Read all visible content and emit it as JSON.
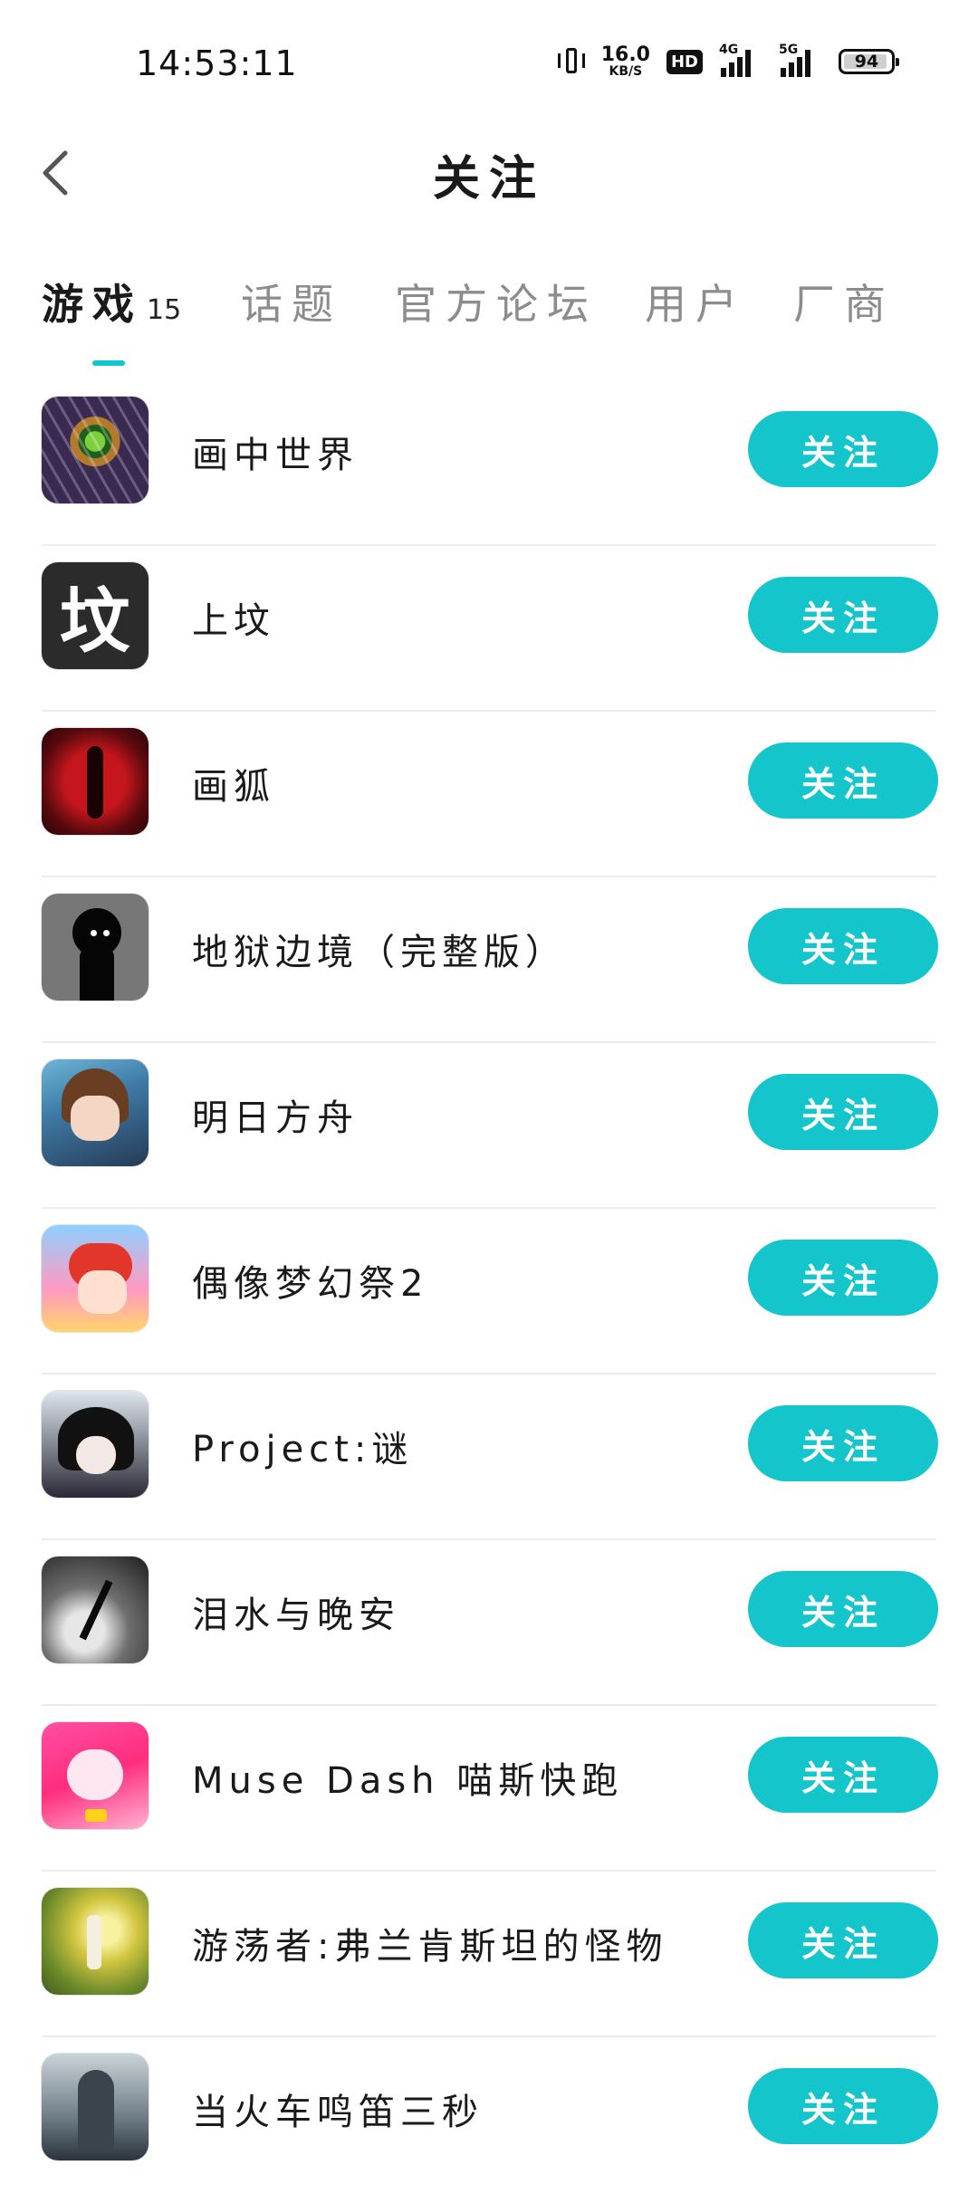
{
  "status_bar": {
    "time": "14:53:11",
    "net_speed_value": "16.0",
    "net_speed_unit": "KB/S",
    "hd_label": "HD",
    "sim1_label": "4G",
    "sim2_label": "5G",
    "battery_level": "94",
    "battery_fraction": 0.94
  },
  "header": {
    "title": "关注",
    "back_icon": "chevron-left-icon"
  },
  "tabs": [
    {
      "label": "游戏",
      "count": "15",
      "active": true
    },
    {
      "label": "话题",
      "active": false
    },
    {
      "label": "官方论坛",
      "active": false
    },
    {
      "label": "用户",
      "active": false
    },
    {
      "label": "厂商",
      "active": false
    }
  ],
  "accent_color": "#14c5cc",
  "follow_label": "关注",
  "games": [
    {
      "name": "画中世界",
      "icon": "game-icon-painting-world"
    },
    {
      "name": "上坟",
      "icon": "game-icon-shangfen",
      "icon_text": "坟"
    },
    {
      "name": "画狐",
      "icon": "game-icon-huahu"
    },
    {
      "name": "地狱边境（完整版）",
      "icon": "game-icon-limbo"
    },
    {
      "name": "明日方舟",
      "icon": "game-icon-arknights"
    },
    {
      "name": "偶像梦幻祭2",
      "icon": "game-icon-ensemble-stars"
    },
    {
      "name": "Project:谜",
      "icon": "game-icon-project-mi"
    },
    {
      "name": "泪水与晚安",
      "icon": "game-icon-tears-goodnight"
    },
    {
      "name": "Muse Dash 喵斯快跑",
      "icon": "game-icon-muse-dash"
    },
    {
      "name": "游荡者:弗兰肯斯坦的怪物",
      "icon": "game-icon-wanderer"
    },
    {
      "name": "当火车鸣笛三秒",
      "icon": "game-icon-train-whistle"
    }
  ]
}
